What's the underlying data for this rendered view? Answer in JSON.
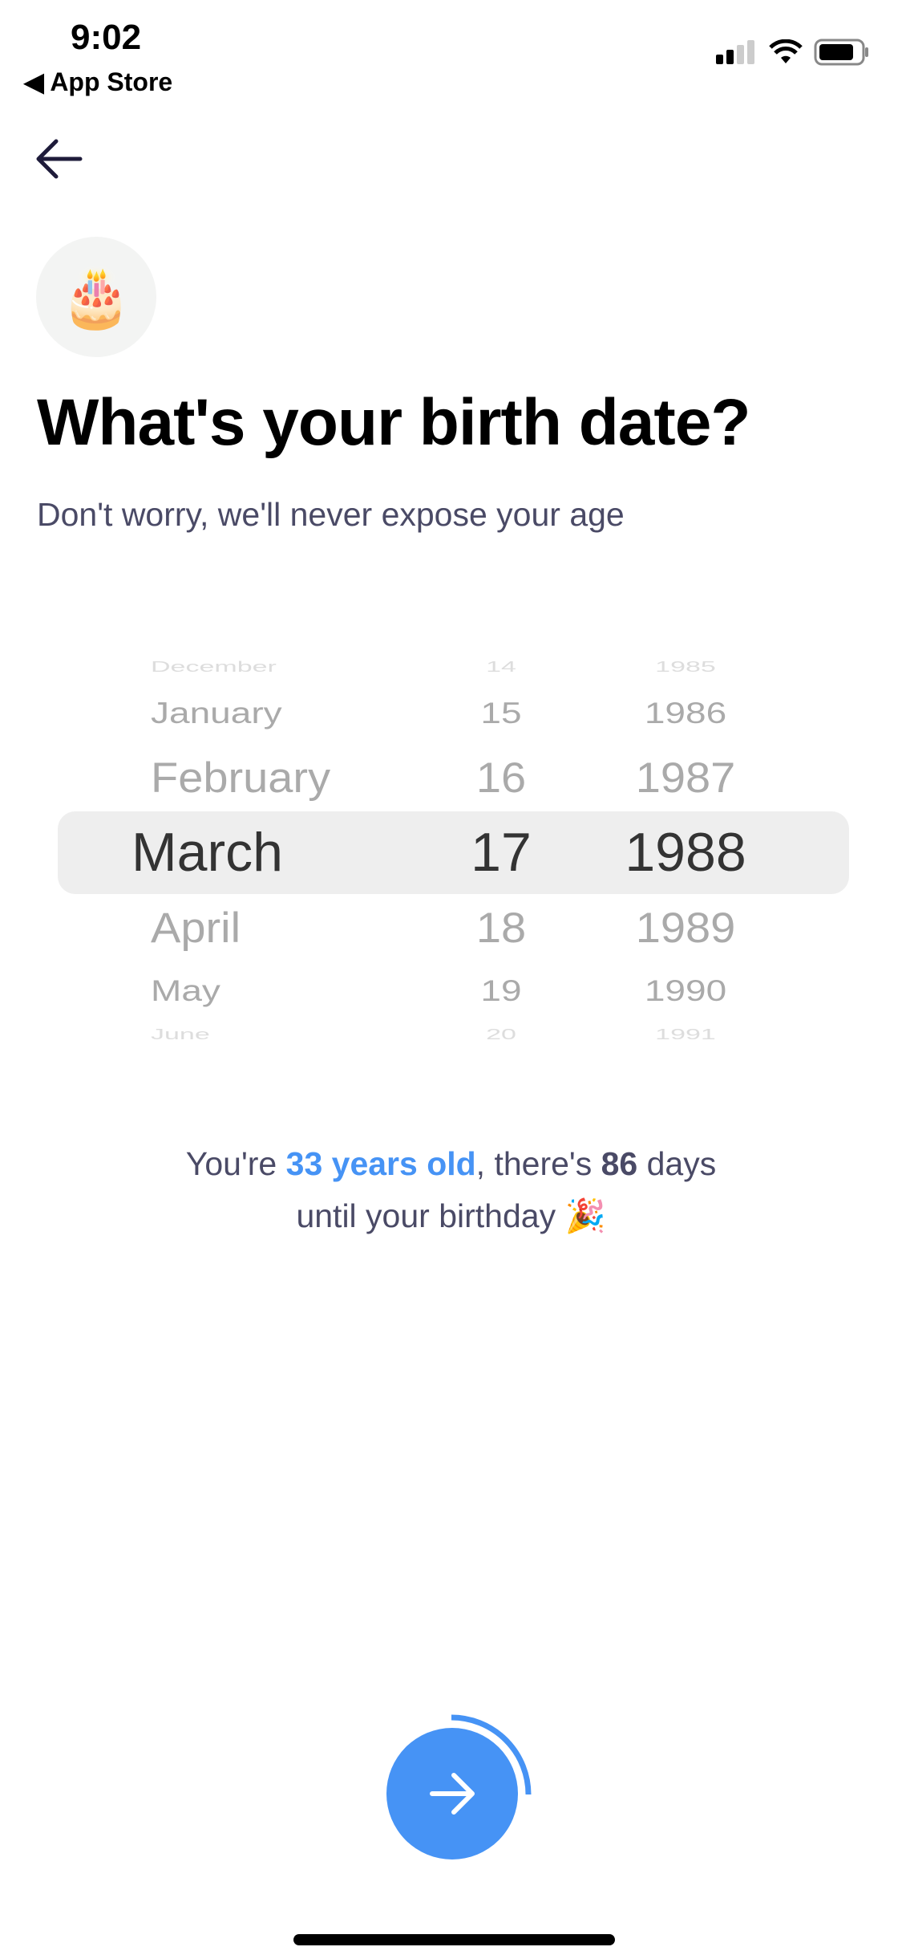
{
  "status_bar": {
    "time": "9:02",
    "back_app": "◀ App Store",
    "signal_bars": 2,
    "battery_level": 0.8
  },
  "nav": {
    "back_icon": "arrow-left-icon"
  },
  "header": {
    "emoji": "🎂",
    "title": "What's your birth date?",
    "subtitle": "Don't worry, we'll never expose your age"
  },
  "picker": {
    "months": [
      "December",
      "January",
      "February",
      "March",
      "April",
      "May",
      "June"
    ],
    "days": [
      "14",
      "15",
      "16",
      "17",
      "18",
      "19",
      "20"
    ],
    "years": [
      "1985",
      "1986",
      "1987",
      "1988",
      "1989",
      "1990",
      "1991"
    ],
    "selected": {
      "month": "March",
      "day": "17",
      "year": "1988"
    }
  },
  "info": {
    "prefix": "You're ",
    "age": "33 years old",
    "middle": ", there's ",
    "days": "86",
    "suffix": " days",
    "line2": "until your birthday",
    "emoji": "🎉"
  },
  "next_button": {
    "icon": "arrow-right-icon",
    "progress": 0.25
  },
  "colors": {
    "accent": "#4693f5",
    "text_secondary": "#4a4a66",
    "highlight": "#eeeeee"
  }
}
